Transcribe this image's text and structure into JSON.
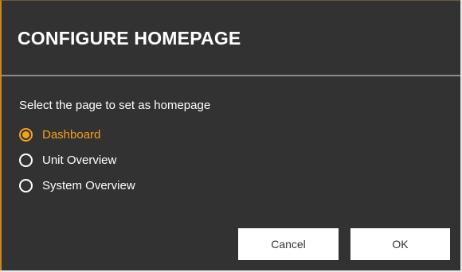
{
  "dialog": {
    "title": "CONFIGURE HOMEPAGE",
    "prompt": "Select the page to set as homepage",
    "options": [
      {
        "label": "Dashboard",
        "selected": true
      },
      {
        "label": "Unit Overview",
        "selected": false
      },
      {
        "label": "System Overview",
        "selected": false
      }
    ],
    "buttons": {
      "cancel_label": "Cancel",
      "ok_label": "OK"
    },
    "colors": {
      "background": "#323232",
      "accent": "#f5a11b",
      "text": "#ffffff",
      "button_bg": "#ffffff"
    }
  }
}
